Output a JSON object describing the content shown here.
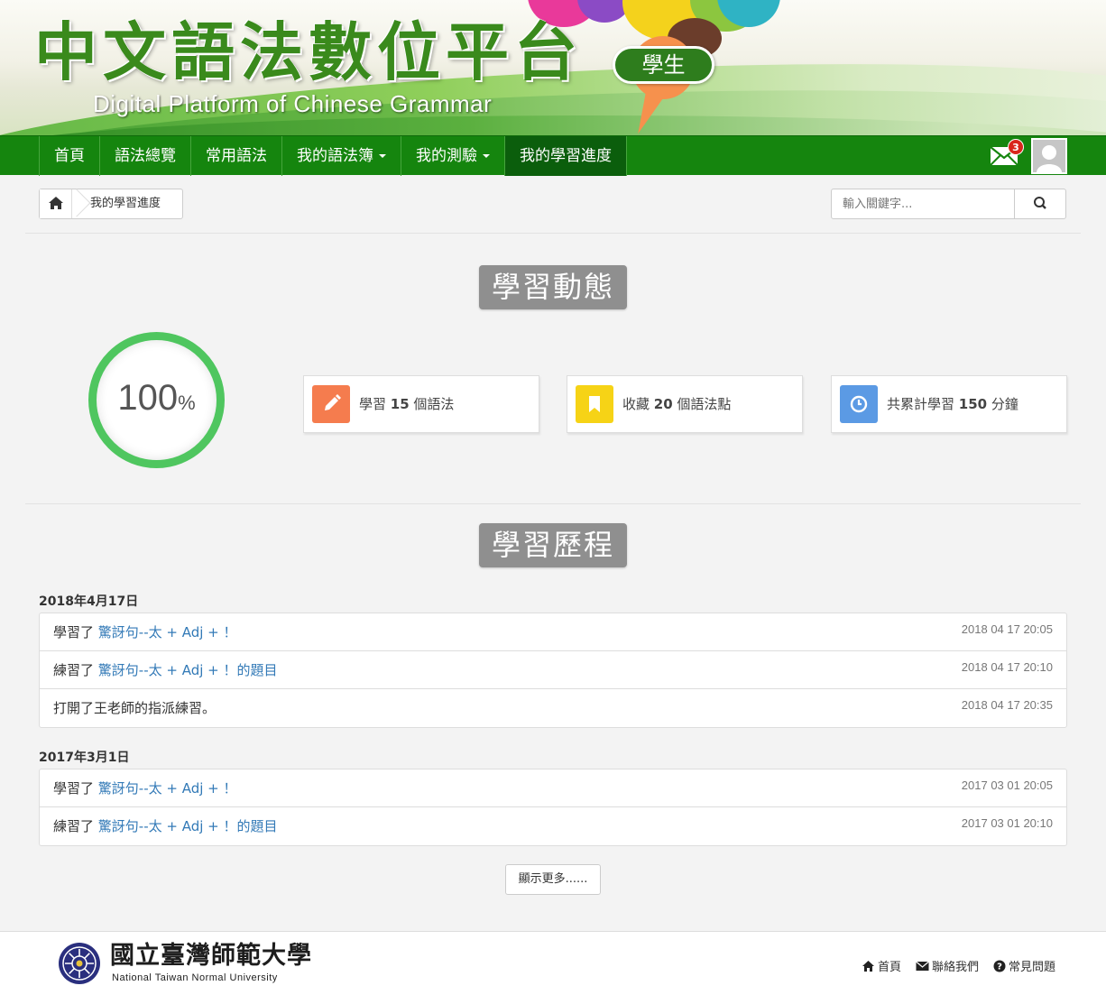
{
  "header": {
    "title": "中文語法數位平台",
    "subtitle": "Digital Platform of Chinese Grammar",
    "role": "學生"
  },
  "nav": {
    "items": [
      {
        "label": "首頁",
        "dropdown": false,
        "active": false
      },
      {
        "label": "語法總覽",
        "dropdown": false,
        "active": false
      },
      {
        "label": "常用語法",
        "dropdown": false,
        "active": false
      },
      {
        "label": "我的語法簿",
        "dropdown": true,
        "active": false
      },
      {
        "label": "我的測驗",
        "dropdown": true,
        "active": false
      },
      {
        "label": "我的學習進度",
        "dropdown": false,
        "active": true
      }
    ],
    "mail_count": "3"
  },
  "breadcrumb": {
    "current": "我的學習進度"
  },
  "search": {
    "placeholder": "輸入關鍵字..."
  },
  "dynamics": {
    "title": "學習動態",
    "progress_value": "100",
    "progress_unit": "%",
    "progress_percent": 100,
    "cards": [
      {
        "prefix": "學習 ",
        "num": "15",
        "suffix": " 個語法",
        "icon": "pencil-icon",
        "color": "#f57c4e"
      },
      {
        "prefix": "收藏 ",
        "num": "20",
        "suffix": " 個語法點",
        "icon": "bookmark-icon",
        "color": "#f6d316"
      },
      {
        "prefix": "共累計學習 ",
        "num": "150",
        "suffix": " 分鐘",
        "icon": "clock-icon",
        "color": "#5b9ae4"
      }
    ]
  },
  "history": {
    "title": "學習歷程",
    "groups": [
      {
        "date": "2018年4月17日",
        "entries": [
          {
            "prefix": "學習了 ",
            "link": "驚訝句--太 + Adj + ！",
            "suffix": "",
            "time": "2018 04 17 20:05"
          },
          {
            "prefix": "練習了 ",
            "link": "驚訝句--太 + Adj + ！的題目",
            "suffix": "",
            "time": "2018 04 17 20:10"
          },
          {
            "prefix": "打開了王老師的指派練習。",
            "link": "",
            "suffix": "",
            "time": "2018 04 17 20:35"
          }
        ]
      },
      {
        "date": "2017年3月1日",
        "entries": [
          {
            "prefix": "學習了 ",
            "link": "驚訝句--太 + Adj + ！",
            "suffix": "",
            "time": "2017 03 01 20:05"
          },
          {
            "prefix": "練習了 ",
            "link": "驚訝句--太 + Adj + ！的題目",
            "suffix": "",
            "time": "2017 03 01 20:10"
          }
        ]
      }
    ],
    "more_label": "顯示更多......"
  },
  "footer": {
    "university": "國立臺灣師範大學",
    "university_en": "National Taiwan Normal University",
    "links": [
      {
        "label": "首頁",
        "icon": "home-icon"
      },
      {
        "label": "聯絡我們",
        "icon": "envelope-icon"
      },
      {
        "label": "常見問題",
        "icon": "question-circle-icon"
      }
    ]
  },
  "colors": {
    "nav_green": "#15850e",
    "ring_green": "#4fc65f",
    "link_blue": "#337ab7"
  }
}
